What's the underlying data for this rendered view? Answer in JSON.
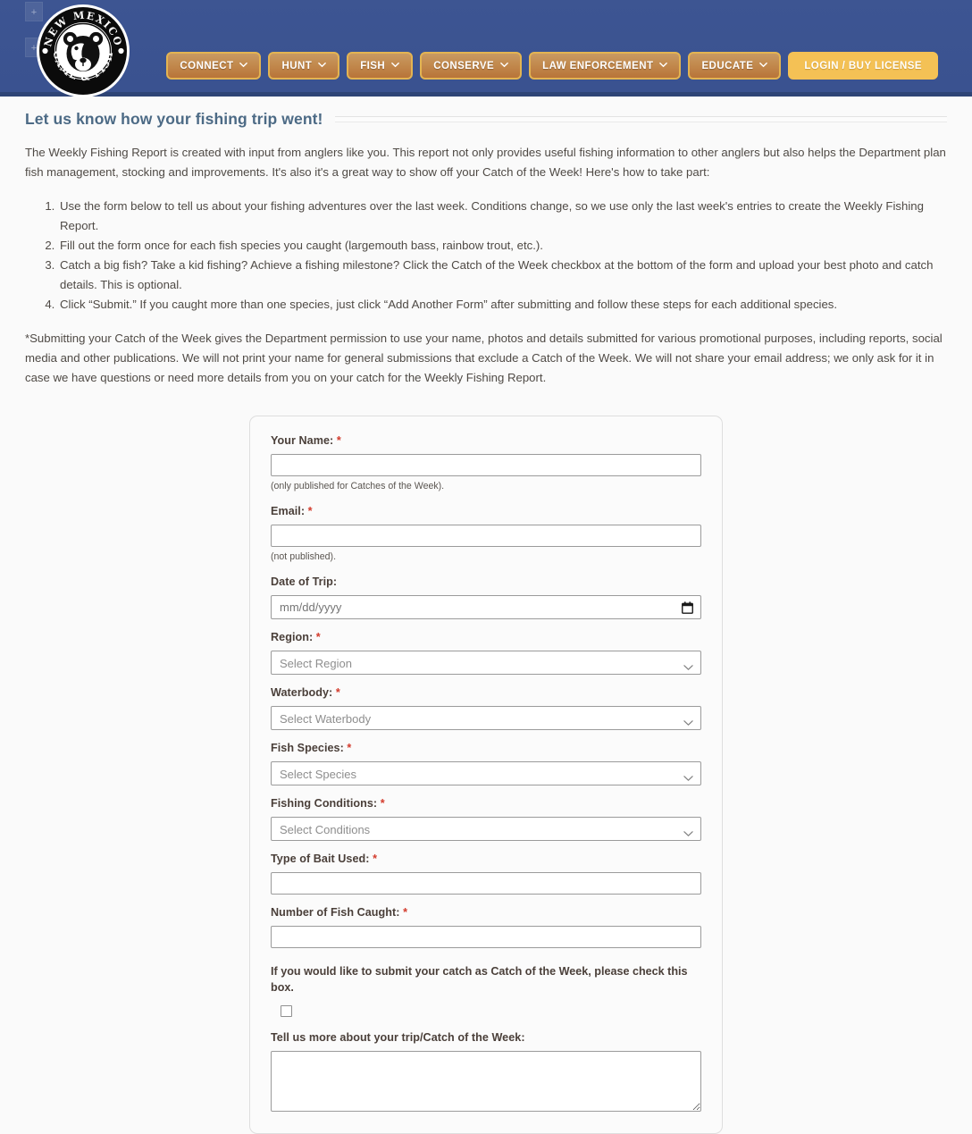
{
  "header": {
    "logo": {
      "name": "nm-game-and-fish-logo",
      "top_text": "NEW MEXICO",
      "bottom_text": "GAME & FISH"
    },
    "accessibility_widgets": [
      {
        "name": "zoom-in-widget-top",
        "label": "+"
      },
      {
        "name": "zoom-in-widget-bottom",
        "label": "+"
      }
    ],
    "nav": [
      {
        "label": "CONNECT",
        "has_caret": true,
        "variant": "default"
      },
      {
        "label": "HUNT",
        "has_caret": true,
        "variant": "default"
      },
      {
        "label": "FISH",
        "has_caret": true,
        "variant": "default"
      },
      {
        "label": "CONSERVE",
        "has_caret": true,
        "variant": "default"
      },
      {
        "label": "LAW ENFORCEMENT",
        "has_caret": true,
        "variant": "default"
      },
      {
        "label": "EDUCATE",
        "has_caret": true,
        "variant": "default"
      },
      {
        "label": "LOGIN / BUY LICENSE",
        "has_caret": false,
        "variant": "login"
      }
    ]
  },
  "colors": {
    "header_blue": "#3b5390",
    "header_blue_dark": "#2e4476",
    "nav_gold_border": "#e3b452",
    "nav_button_top": "#c99a62",
    "nav_button_bottom": "#b87439",
    "login_button": "#f4c155",
    "heading_slate": "#4c6a85",
    "body_text": "#4f4a45",
    "label_text": "#4a3f39",
    "required_red": "#d33b2c",
    "page_background": "#fafafa",
    "card_background": "#fbfbfb",
    "card_border": "#dedede",
    "input_border": "#9b9b9b"
  },
  "main": {
    "page_title": "Let us know how your fishing trip went!",
    "intro_paragraph": "The Weekly Fishing Report is created with input from anglers like you. This report not only provides useful fishing information to other anglers but also helps the Department plan fish management, stocking and improvements. It's also it's a great way to show off your Catch of the Week! Here's how to take part:",
    "steps": [
      "Use the form below to tell us about your fishing adventures over the last week. Conditions change, so we use only the last week's entries to create the Weekly Fishing Report.",
      "Fill out the form once for each fish species you caught (largemouth bass, rainbow trout, etc.).",
      "Catch a big fish? Take a kid fishing? Achieve a fishing milestone? Click the Catch of the Week checkbox at the bottom of the form and upload your best photo and catch details. This is optional.",
      "Click “Submit.” If you caught more than one species, just click “Add Another Form” after submitting and follow these steps for each additional species."
    ],
    "disclaimer": "*Submitting your Catch of the Week gives the Department permission to use your name, photos and details submitted for various promotional purposes, including reports, social media and other publications. We will not print your name for general submissions that exclude a Catch of the Week. We will not share your email address; we only ask for it in case we have questions or need more details from you on your catch for the Weekly Fishing Report."
  },
  "form": {
    "fields": {
      "your_name": {
        "label": "Your Name:",
        "required_mark": "*",
        "value": "",
        "placeholder": "",
        "hint": "(only published for Catches of the Week)."
      },
      "email": {
        "label": "Email:",
        "required_mark": "*",
        "value": "",
        "placeholder": "",
        "hint": "(not published)."
      },
      "date_of_trip": {
        "label": "Date of Trip:",
        "required_mark": "",
        "value": "",
        "placeholder": "mm/dd/yyyy",
        "icon": "calendar-icon"
      },
      "region": {
        "label": "Region:",
        "required_mark": "*",
        "selected": "Select Region",
        "icon": "chevron-down-icon"
      },
      "waterbody": {
        "label": "Waterbody:",
        "required_mark": "*",
        "selected": "Select Waterbody",
        "icon": "chevron-down-icon"
      },
      "fish_species": {
        "label": "Fish Species:",
        "required_mark": "*",
        "selected": "Select Species",
        "icon": "chevron-down-icon"
      },
      "fishing_conditions": {
        "label": "Fishing Conditions:",
        "required_mark": "*",
        "selected": "Select Conditions",
        "icon": "chevron-down-icon"
      },
      "bait_type": {
        "label": "Type of Bait Used:",
        "required_mark": "*",
        "value": "",
        "placeholder": ""
      },
      "number_of_fish": {
        "label": "Number of Fish Caught:",
        "required_mark": "*",
        "value": "",
        "placeholder": ""
      },
      "catch_of_the_week": {
        "label": "If you would like to submit your catch as Catch of the Week, please check this box.",
        "checked": false
      },
      "trip_details": {
        "label": "Tell us more about your trip/Catch of the Week:",
        "required_mark": "",
        "value": "",
        "placeholder": ""
      }
    }
  }
}
